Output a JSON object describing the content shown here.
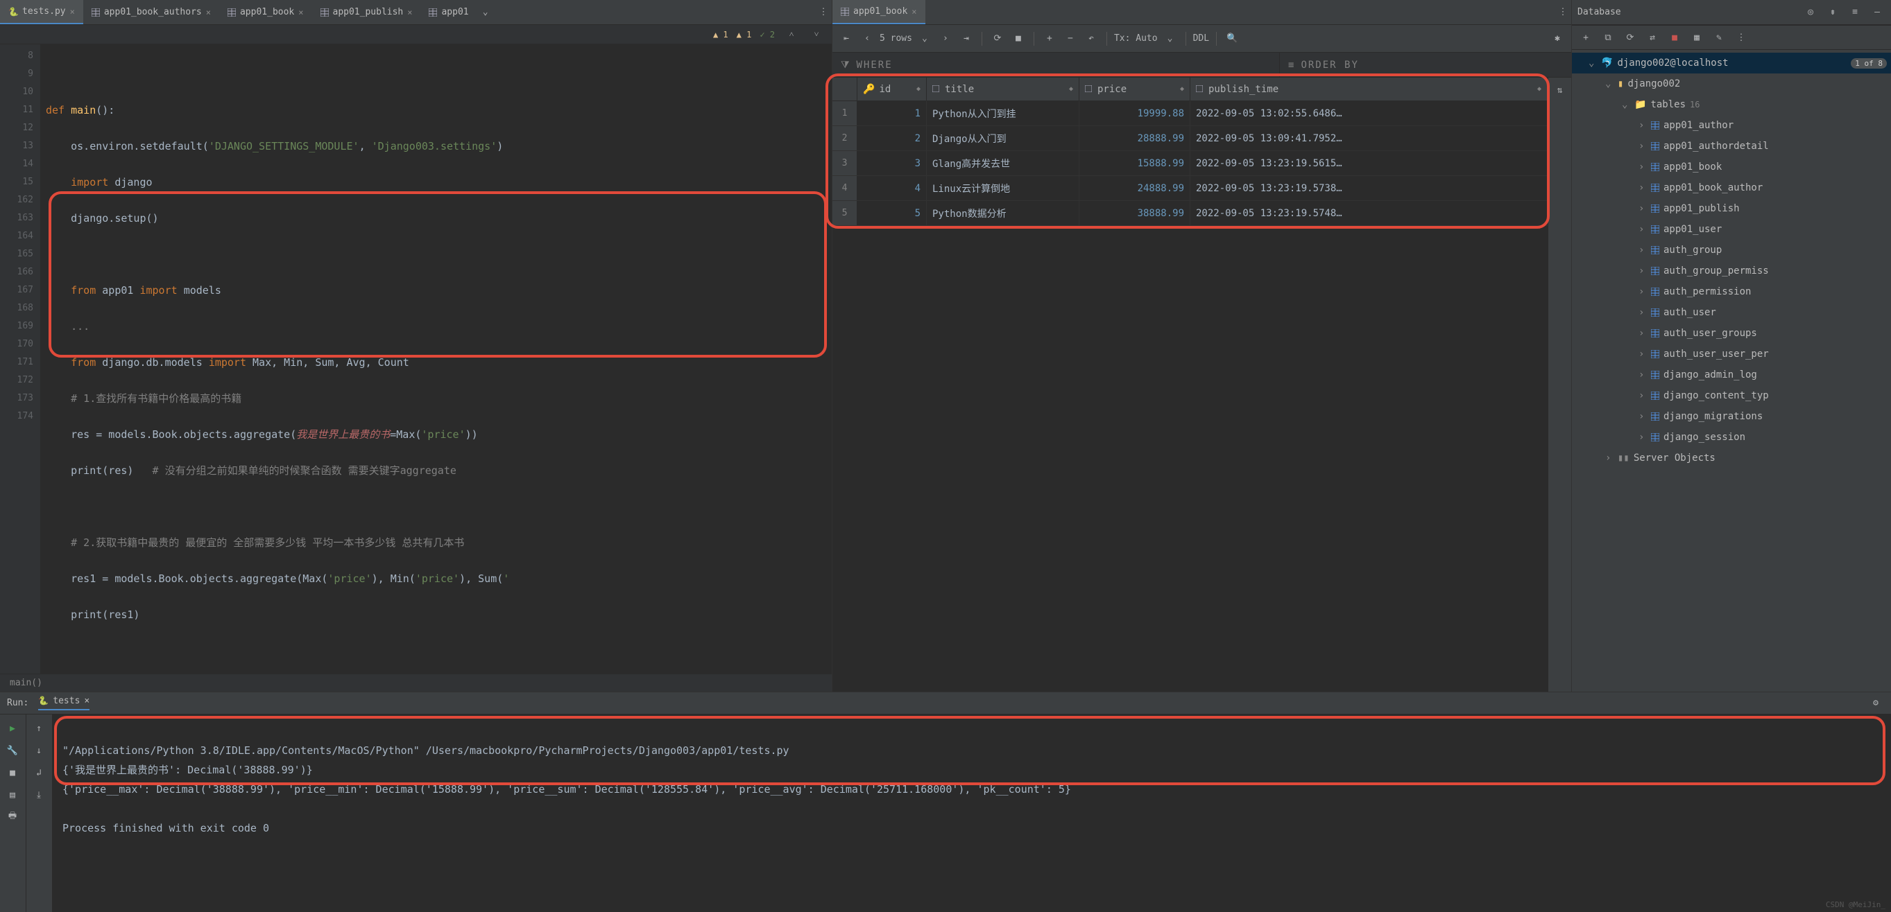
{
  "tabs": {
    "editor": [
      {
        "label": "tests.py",
        "icon": "python",
        "active": true
      },
      {
        "label": "app01_book_authors",
        "icon": "table"
      },
      {
        "label": "app01_book",
        "icon": "table"
      },
      {
        "label": "app01_publish",
        "icon": "table"
      },
      {
        "label": "app01",
        "icon": "table",
        "truncated": true
      }
    ],
    "data_tab": "app01_book"
  },
  "inspections": {
    "warn1": "1",
    "warn2": "1",
    "ok": "2"
  },
  "gutter": [
    "8",
    "9",
    "10",
    "11",
    "12",
    "13",
    "14",
    "15",
    "162",
    "163",
    "164",
    "165",
    "166",
    "167",
    "168",
    "169",
    "170",
    "171",
    "172",
    "173",
    "174"
  ],
  "code": {
    "l9a": "def ",
    "l9b": "main",
    "l9c": "():",
    "l10": "    os.environ.setdefault(",
    "l10s1": "'DJANGO_SETTINGS_MODULE'",
    "l10m": ", ",
    "l10s2": "'Django003.settings'",
    "l10e": ")",
    "l11a": "    import ",
    "l11b": "django",
    "l12": "    django.setup()",
    "l14a": "    from ",
    "l14b": "app01 ",
    "l14c": "import ",
    "l14d": "models",
    "l15": "    ...",
    "l162a": "    from ",
    "l162b": "django.db.models ",
    "l162c": "import ",
    "l162d": "Max, Min, Sum, Avg, Count",
    "l163": "    # 1.查找所有书籍中价格最高的书籍",
    "l164a": "    res = models.Book.objects.aggregate(",
    "l164p": "我是世界上最贵的书",
    "l164b": "=Max(",
    "l164s": "'price'",
    "l164c": "))",
    "l165a": "    print(res)   ",
    "l165c": "# 没有分组之前如果单纯的时候聚合函数 需要关键字aggregate",
    "l167": "    # 2.获取书籍中最贵的 最便宜的 全部需要多少钱 平均一本书多少钱 总共有几本书",
    "l168a": "    res1 = models.Book.objects.aggregate(Max(",
    "l168s1": "'price'",
    "l168b": "), Min(",
    "l168s2": "'price'",
    "l168c": "), Sum(",
    "l168s3": "'",
    "l169": "    print(res1)"
  },
  "breadcrumb": "main()",
  "data_toolbar": {
    "rows": "5 rows",
    "tx": "Tx: Auto",
    "ddl": "DDL"
  },
  "filter": {
    "where_label": "WHERE",
    "order_label": "ORDER BY"
  },
  "columns": [
    "id",
    "title",
    "price",
    "publish_time"
  ],
  "rows": [
    {
      "n": "1",
      "id": "1",
      "title": "Python从入门到挂",
      "price": "19999.88",
      "time": "2022-09-05 13:02:55.6486…"
    },
    {
      "n": "2",
      "id": "2",
      "title": "Django从入门到",
      "price": "28888.99",
      "time": "2022-09-05 13:09:41.7952…"
    },
    {
      "n": "3",
      "id": "3",
      "title": "Glang高并发去世",
      "price": "15888.99",
      "time": "2022-09-05 13:23:19.5615…"
    },
    {
      "n": "4",
      "id": "4",
      "title": "Linux云计算倒地",
      "price": "24888.99",
      "time": "2022-09-05 13:23:19.5738…"
    },
    {
      "n": "5",
      "id": "5",
      "title": "Python数据分析",
      "price": "38888.99",
      "time": "2022-09-05 13:23:19.5748…"
    }
  ],
  "database_panel": {
    "title": "Database",
    "datasource": "django002@localhost",
    "badge": "1 of 8",
    "schema": "django002",
    "tables_label": "tables",
    "tables_count": "16",
    "tables": [
      "app01_author",
      "app01_authordetail",
      "app01_book",
      "app01_book_author",
      "app01_publish",
      "app01_user",
      "auth_group",
      "auth_group_permiss",
      "auth_permission",
      "auth_user",
      "auth_user_groups",
      "auth_user_user_per",
      "django_admin_log",
      "django_content_typ",
      "django_migrations",
      "django_session"
    ],
    "server_objects": "Server Objects"
  },
  "run": {
    "label": "Run:",
    "tab": "tests",
    "cmd": "\"/Applications/Python 3.8/IDLE.app/Contents/MacOS/Python\" /Users/macbookpro/PycharmProjects/Django003/app01/tests.py",
    "out1": "{'我是世界上最贵的书': Decimal('38888.99')}",
    "out2": "{'price__max': Decimal('38888.99'), 'price__min': Decimal('15888.99'), 'price__sum': Decimal('128555.84'), 'price__avg': Decimal('25711.168000'), 'pk__count': 5}",
    "exit": "Process finished with exit code 0"
  },
  "watermark": "CSDN @MeiJin_"
}
